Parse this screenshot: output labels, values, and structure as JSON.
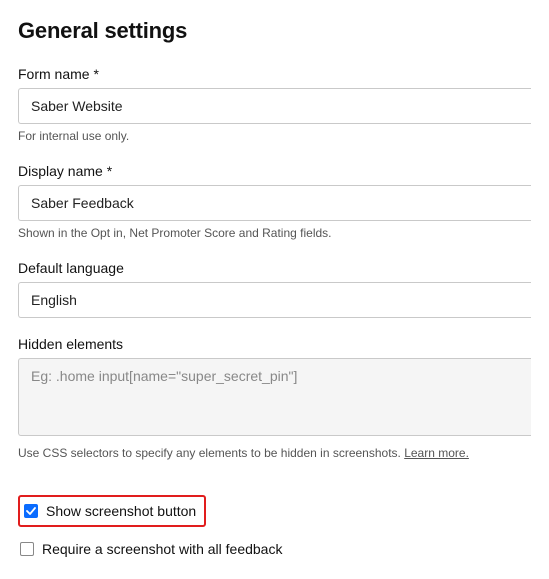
{
  "page_title": "General settings",
  "form_name": {
    "label": "Form name *",
    "value": "Saber Website",
    "help": "For internal use only."
  },
  "display_name": {
    "label": "Display name *",
    "value": "Saber Feedback",
    "help": "Shown in the Opt in, Net Promoter Score and Rating fields."
  },
  "default_language": {
    "label": "Default language",
    "value": "English"
  },
  "hidden_elements": {
    "label": "Hidden elements",
    "placeholder": "Eg: .home input[name=\"super_secret_pin\"]",
    "help_prefix": "Use CSS selectors to specify any elements to be hidden in screenshots. ",
    "help_link": "Learn more."
  },
  "checkbox_show_screenshot": "Show screenshot button",
  "checkbox_require_screenshot": "Require a screenshot with all feedback"
}
